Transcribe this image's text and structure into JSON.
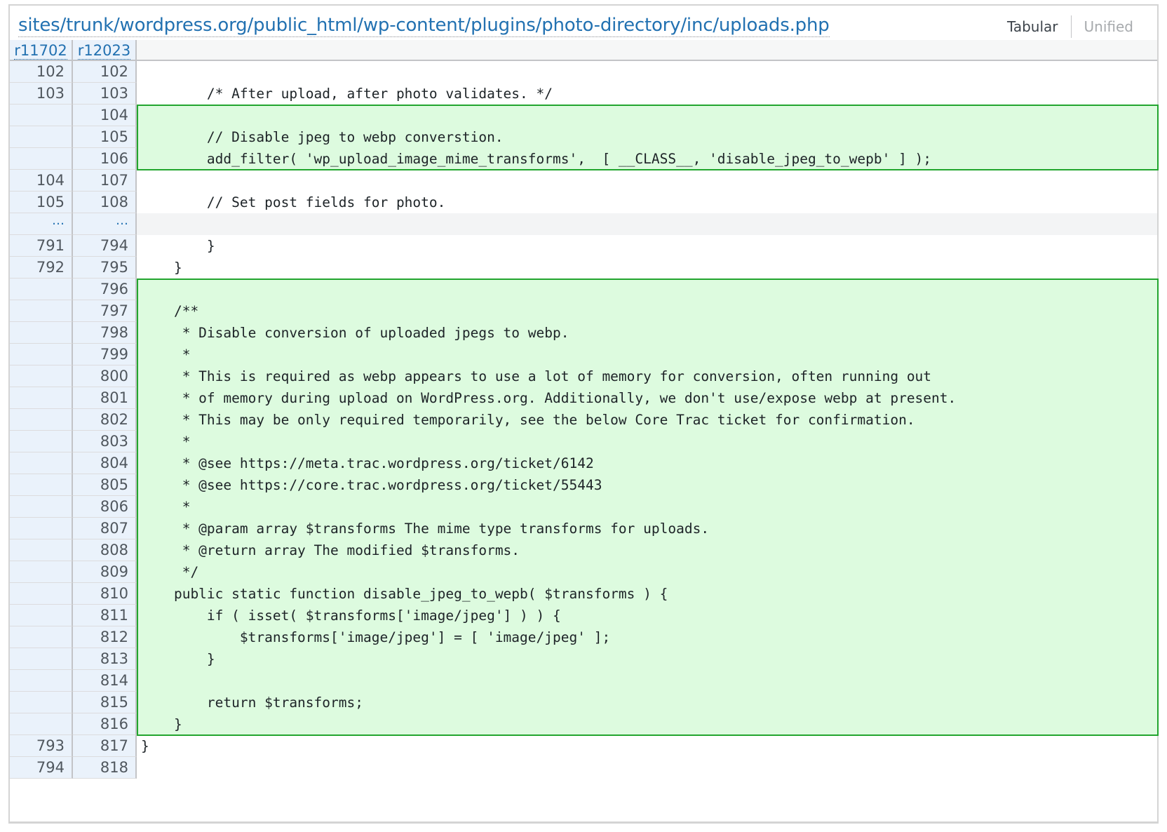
{
  "header": {
    "file_path": "sites/trunk/wordpress.org/public_html/wp-content/plugins/photo-directory/inc/uploads.php",
    "tabs": [
      {
        "label": "Tabular",
        "active": true
      },
      {
        "label": "Unified",
        "active": false
      }
    ]
  },
  "columns": {
    "old_rev": "r11702",
    "new_rev": "r12023"
  },
  "colors": {
    "added_bg": "#ddfbdf",
    "added_border": "#22a52e",
    "line_number_bg": "#eaf2fb",
    "link": "#2271b1"
  },
  "rows": [
    {
      "old": "102",
      "new": "102",
      "code": "",
      "type": "context"
    },
    {
      "old": "103",
      "new": "103",
      "code": "        /* After upload, after photo validates. */",
      "type": "context"
    },
    {
      "old": "",
      "new": "104",
      "code": "",
      "type": "added"
    },
    {
      "old": "",
      "new": "105",
      "code": "        // Disable jpeg to webp converstion.",
      "type": "added"
    },
    {
      "old": "",
      "new": "106",
      "code": "        add_filter( 'wp_upload_image_mime_transforms',  [ __CLASS__, 'disable_jpeg_to_wepb' ] );",
      "type": "added"
    },
    {
      "old": "104",
      "new": "107",
      "code": "",
      "type": "context"
    },
    {
      "old": "105",
      "new": "108",
      "code": "        // Set post fields for photo.",
      "type": "context"
    },
    {
      "old": "…",
      "new": "…",
      "code": "",
      "type": "skip"
    },
    {
      "old": "791",
      "new": "794",
      "code": "        }",
      "type": "context"
    },
    {
      "old": "792",
      "new": "795",
      "code": "    }",
      "type": "context"
    },
    {
      "old": "",
      "new": "796",
      "code": "",
      "type": "added"
    },
    {
      "old": "",
      "new": "797",
      "code": "    /**",
      "type": "added"
    },
    {
      "old": "",
      "new": "798",
      "code": "     * Disable conversion of uploaded jpegs to webp.",
      "type": "added"
    },
    {
      "old": "",
      "new": "799",
      "code": "     *",
      "type": "added"
    },
    {
      "old": "",
      "new": "800",
      "code": "     * This is required as webp appears to use a lot of memory for conversion, often running out",
      "type": "added"
    },
    {
      "old": "",
      "new": "801",
      "code": "     * of memory during upload on WordPress.org. Additionally, we don't use/expose webp at present.",
      "type": "added"
    },
    {
      "old": "",
      "new": "802",
      "code": "     * This may be only required temporarily, see the below Core Trac ticket for confirmation.",
      "type": "added"
    },
    {
      "old": "",
      "new": "803",
      "code": "     *",
      "type": "added"
    },
    {
      "old": "",
      "new": "804",
      "code": "     * @see https://meta.trac.wordpress.org/ticket/6142",
      "type": "added"
    },
    {
      "old": "",
      "new": "805",
      "code": "     * @see https://core.trac.wordpress.org/ticket/55443",
      "type": "added"
    },
    {
      "old": "",
      "new": "806",
      "code": "     *",
      "type": "added"
    },
    {
      "old": "",
      "new": "807",
      "code": "     * @param array $transforms The mime type transforms for uploads.",
      "type": "added"
    },
    {
      "old": "",
      "new": "808",
      "code": "     * @return array The modified $transforms.",
      "type": "added"
    },
    {
      "old": "",
      "new": "809",
      "code": "     */",
      "type": "added"
    },
    {
      "old": "",
      "new": "810",
      "code": "    public static function disable_jpeg_to_wepb( $transforms ) {",
      "type": "added"
    },
    {
      "old": "",
      "new": "811",
      "code": "        if ( isset( $transforms['image/jpeg'] ) ) {",
      "type": "added"
    },
    {
      "old": "",
      "new": "812",
      "code": "            $transforms['image/jpeg'] = [ 'image/jpeg' ];",
      "type": "added"
    },
    {
      "old": "",
      "new": "813",
      "code": "        }",
      "type": "added"
    },
    {
      "old": "",
      "new": "814",
      "code": "",
      "type": "added"
    },
    {
      "old": "",
      "new": "815",
      "code": "        return $transforms;",
      "type": "added"
    },
    {
      "old": "",
      "new": "816",
      "code": "    }",
      "type": "added"
    },
    {
      "old": "793",
      "new": "817",
      "code": "}",
      "type": "context"
    },
    {
      "old": "794",
      "new": "818",
      "code": "",
      "type": "context"
    }
  ]
}
